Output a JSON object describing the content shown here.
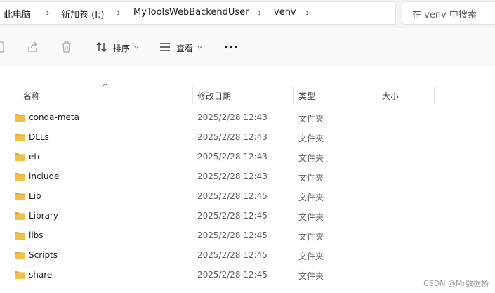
{
  "breadcrumb": {
    "items": [
      "此电脑",
      "新加卷 (I:)",
      "MyToolsWebBackendUser",
      "venv"
    ]
  },
  "search": {
    "placeholder": "在 venv 中搜索"
  },
  "toolbar": {
    "sort_label": "排序",
    "view_label": "查看",
    "more_label": "···"
  },
  "columns": {
    "name": "名称",
    "modified": "修改日期",
    "type": "类型",
    "size": "大小"
  },
  "files": [
    {
      "name": "conda-meta",
      "modified": "2025/2/28 12:43",
      "type": "文件夹",
      "size": ""
    },
    {
      "name": "DLLs",
      "modified": "2025/2/28 12:43",
      "type": "文件夹",
      "size": ""
    },
    {
      "name": "etc",
      "modified": "2025/2/28 12:43",
      "type": "文件夹",
      "size": ""
    },
    {
      "name": "include",
      "modified": "2025/2/28 12:43",
      "type": "文件夹",
      "size": ""
    },
    {
      "name": "Lib",
      "modified": "2025/2/28 12:45",
      "type": "文件夹",
      "size": ""
    },
    {
      "name": "Library",
      "modified": "2025/2/28 12:45",
      "type": "文件夹",
      "size": ""
    },
    {
      "name": "libs",
      "modified": "2025/2/28 12:45",
      "type": "文件夹",
      "size": ""
    },
    {
      "name": "Scripts",
      "modified": "2025/2/28 12:45",
      "type": "文件夹",
      "size": ""
    },
    {
      "name": "share",
      "modified": "2025/2/28 12:45",
      "type": "文件夹",
      "size": ""
    }
  ],
  "watermark": "CSDN @Mr数据杨",
  "colors": {
    "folder": "#f2c045",
    "folder_dark": "#e3a92b"
  }
}
